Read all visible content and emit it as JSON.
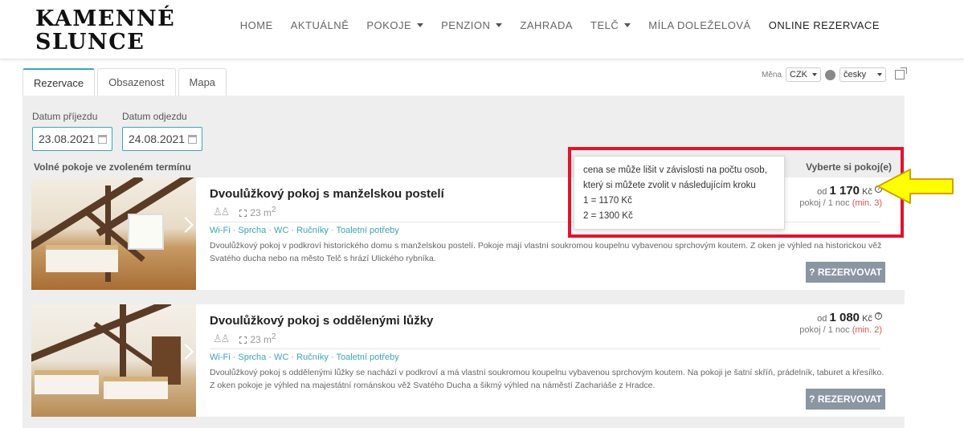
{
  "header": {
    "logo_line1": "KAMENNÉ",
    "logo_line2": "SLUNCE",
    "nav": [
      {
        "label": "HOME",
        "dropdown": false
      },
      {
        "label": "AKTUÁLNĚ",
        "dropdown": false
      },
      {
        "label": "POKOJE",
        "dropdown": true
      },
      {
        "label": "PENZION",
        "dropdown": true
      },
      {
        "label": "ZAHRADA",
        "dropdown": false
      },
      {
        "label": "TELČ",
        "dropdown": true
      },
      {
        "label": "MÍLA DOLEŽELOVÁ",
        "dropdown": false
      },
      {
        "label": "ONLINE REZERVACE",
        "dropdown": false
      }
    ]
  },
  "tabs": [
    {
      "label": "Rezervace",
      "active": true
    },
    {
      "label": "Obsazenost",
      "active": false
    },
    {
      "label": "Mapa",
      "active": false
    }
  ],
  "toolbar": {
    "currency_label": "Měna",
    "currency_value": "CZK",
    "language_value": "česky"
  },
  "dates": {
    "arrival_label": "Datum příjezdu",
    "arrival_value": "23.08.2021",
    "departure_label": "Datum odjezdu",
    "departure_value": "24.08.2021"
  },
  "list": {
    "free_label": "Volné pokoje ve zvoleném termínu",
    "choose_label": "Vyberte si pokoj(e)"
  },
  "rooms": [
    {
      "title": "Dvoulůžkový pokoj s manželskou postelí",
      "area": "23 m",
      "area_sup": "2",
      "amenities": "Wi-Fi · Sprcha · WC · Ručníky · Toaletní potřeby",
      "description": "Dvoulůžkový pokoj v podkroví historického domu s manželskou postelí. Pokoje mají vlastní soukromou koupelnu vybavenou sprchovým koutem. Z oken je výhled na historickou věž Svatého ducha nebo na město Telč s hrází Ulického rybníka.",
      "price_from": "od",
      "price": "1 170",
      "currency": "Kč",
      "price_unit": "pokoj / 1 noc",
      "min": "(min. 3)",
      "button": "REZERVOVAT"
    },
    {
      "title": "Dvoulůžkový pokoj s oddělenými lůžky",
      "area": "23 m",
      "area_sup": "2",
      "amenities": "Wi-Fi · Sprcha · WC · Ručníky · Toaletní potřeby",
      "description": "Dvoulůžkový pokoj s oddělenými lůžky se nachází v podkroví a má vlastní soukromou koupelnu vybavenou sprchovým koutem. Na pokoji je šatní skříň, prádelník, taburet a křesílko. Z oken pokoje je výhled na majestátní románskou věž Svatého Ducha a šikmý výhled na náměstí Zachariáše z Hradce.",
      "price_from": "od",
      "price": "1 080",
      "currency": "Kč",
      "price_unit": "pokoj / 1 noc",
      "min": "(min. 2)",
      "button": "REZERVOVAT"
    }
  ],
  "tooltip": {
    "line1": "cena se může lišit v závislosti na počtu osob,",
    "line2": "který si můžete zvolit v následujícím kroku",
    "line3": "1 = 1170 Kč",
    "line4": "2 = 1300 Kč"
  },
  "colors": {
    "accent": "#3aa6b9",
    "highlight": "#e3132b",
    "arrow_fill": "#ffff00",
    "arrow_stroke": "#d4a000",
    "button": "#8a96a1"
  }
}
